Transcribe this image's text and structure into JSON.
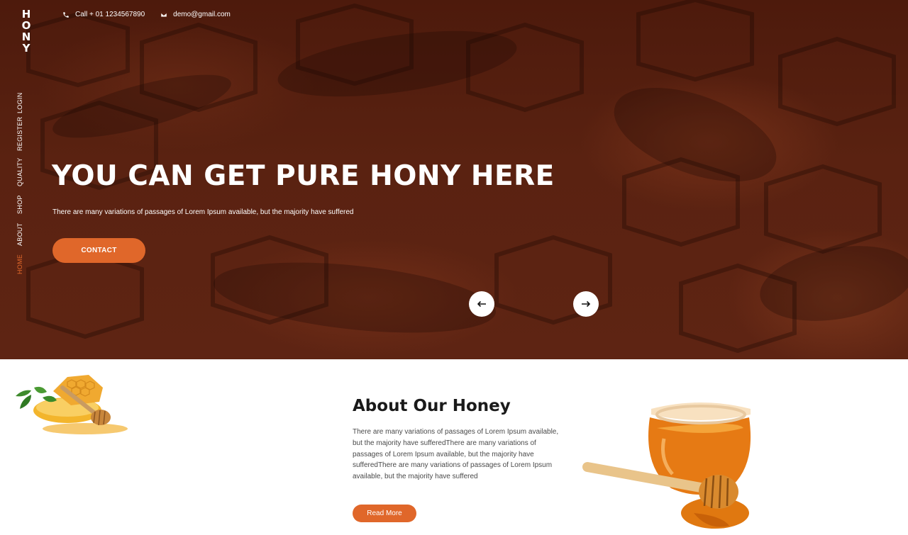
{
  "brand": {
    "name": "HONY"
  },
  "topbar": {
    "phone": "Call + 01 1234567890",
    "email": "demo@gmail.com",
    "phone_icon": "phone-icon",
    "email_icon": "envelope-icon"
  },
  "nav": {
    "items": [
      {
        "label": "LOGIN",
        "active": false
      },
      {
        "label": "REGISTER",
        "active": false
      },
      {
        "label": "QUALITY",
        "active": false
      },
      {
        "label": "SHOP",
        "active": false
      },
      {
        "label": "ABOUT",
        "active": false
      },
      {
        "label": "HOME",
        "active": true
      }
    ]
  },
  "hero": {
    "title": "YOU CAN GET PURE HONY HERE",
    "subtitle": "There are many variations of passages of Lorem Ipsum available, but the majority have suffered",
    "cta_label": "CONTACT",
    "prev_icon": "arrow-left-icon",
    "next_icon": "arrow-right-icon"
  },
  "about": {
    "title": "About Our Honey",
    "text": "There are many variations of passages of Lorem Ipsum available, but the majority have sufferedThere are many variations of passages of Lorem Ipsum available, but the majority have sufferedThere are many variations of passages of Lorem Ipsum available, but the majority have suffered",
    "button_label": "Read More"
  },
  "colors": {
    "accent": "#e0672a",
    "hero_bg": "#5a2211",
    "text_dark": "#1a1a1a"
  }
}
